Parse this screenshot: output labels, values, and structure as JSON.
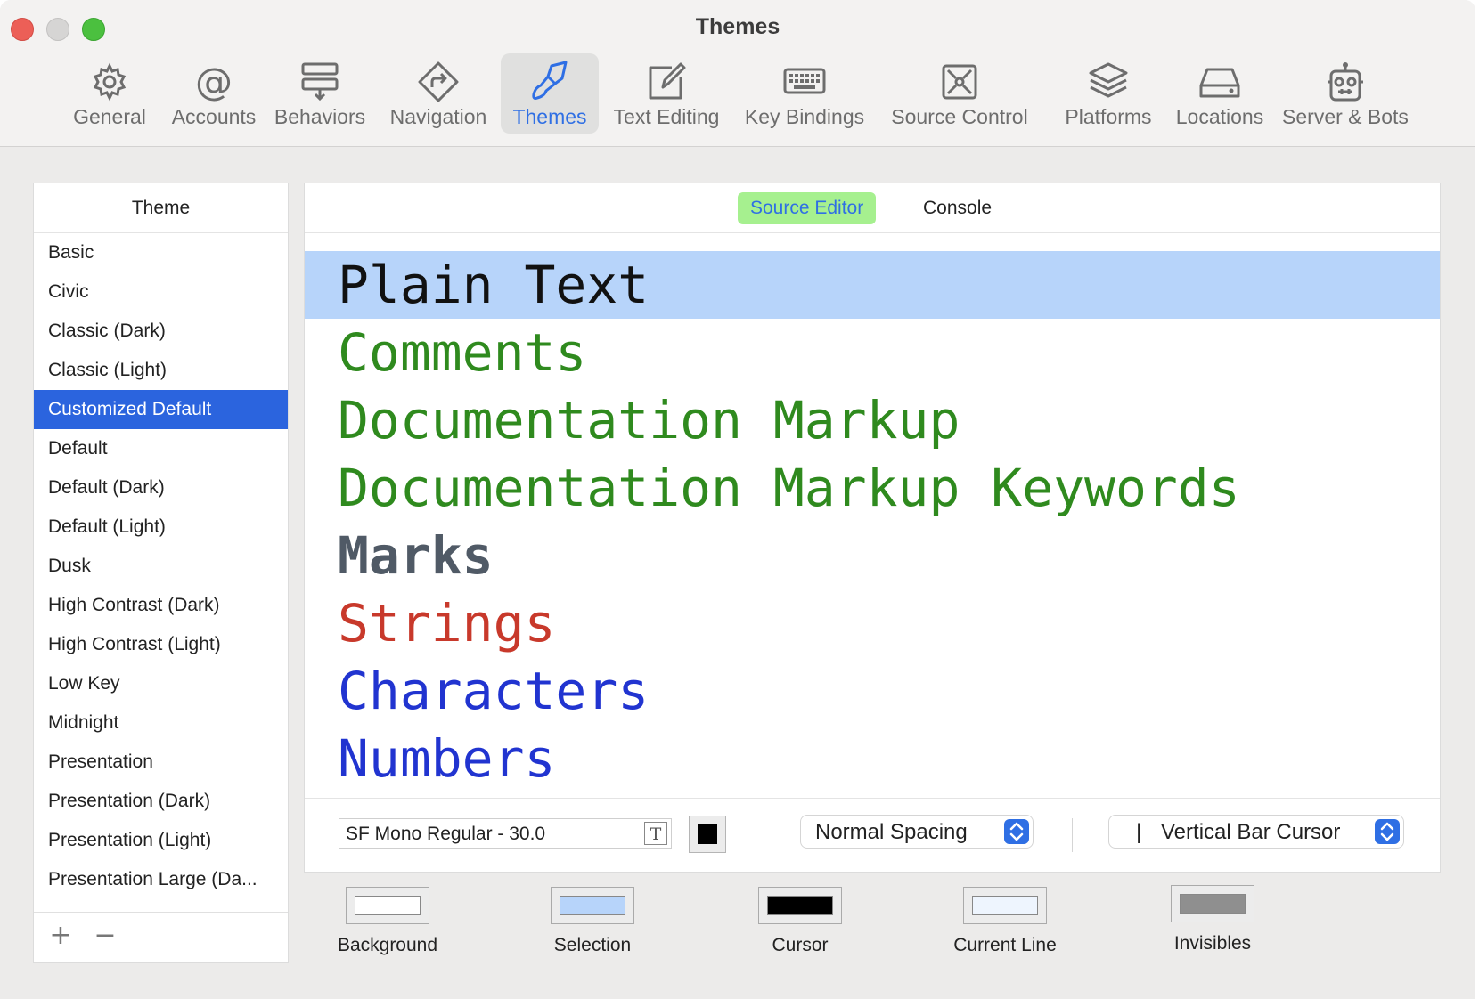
{
  "window": {
    "title": "Themes"
  },
  "toolbar": {
    "items": [
      {
        "label": "General",
        "icon": "gear-icon"
      },
      {
        "label": "Accounts",
        "icon": "at-sign-icon"
      },
      {
        "label": "Behaviors",
        "icon": "behaviors-icon"
      },
      {
        "label": "Navigation",
        "icon": "navigation-arrow-icon"
      },
      {
        "label": "Themes",
        "icon": "paintbrush-icon",
        "selected": true
      },
      {
        "label": "Text Editing",
        "icon": "pencil-square-icon"
      },
      {
        "label": "Key Bindings",
        "icon": "keyboard-icon"
      },
      {
        "label": "Source Control",
        "icon": "source-control-icon"
      },
      {
        "label": "Platforms",
        "icon": "stacked-layers-icon"
      },
      {
        "label": "Locations",
        "icon": "drive-icon"
      },
      {
        "label": "Server & Bots",
        "icon": "robot-icon"
      }
    ]
  },
  "theme_list": {
    "header": "Theme",
    "items": [
      "Basic",
      "Civic",
      "Classic (Dark)",
      "Classic (Light)",
      "Customized Default",
      "Default",
      "Default (Dark)",
      "Default (Light)",
      "Dusk",
      "High Contrast (Dark)",
      "High Contrast (Light)",
      "Low Key",
      "Midnight",
      "Presentation",
      "Presentation (Dark)",
      "Presentation (Light)",
      "Presentation Large (Da..."
    ],
    "selected": "Customized Default",
    "add_label": "+",
    "remove_label": "−"
  },
  "editor": {
    "tabs": {
      "active": "Source Editor",
      "inactive": "Console"
    },
    "samples": [
      {
        "label": "Plain Text",
        "color": "#111111",
        "selected": true
      },
      {
        "label": "Comments",
        "color": "#2f8a1e"
      },
      {
        "label": "Documentation Markup",
        "color": "#2f8a1e"
      },
      {
        "label": "Documentation Markup Keywords",
        "color": "#2f8a1e"
      },
      {
        "label": "Marks",
        "color": "#505a66",
        "bold": true
      },
      {
        "label": "Strings",
        "color": "#c8392b"
      },
      {
        "label": "Characters",
        "color": "#2134d0"
      },
      {
        "label": "Numbers",
        "color": "#2134d0"
      }
    ],
    "font": "SF Mono Regular - 30.0",
    "spacing": "Normal Spacing",
    "cursor_glyph": "|",
    "cursor": "Vertical Bar Cursor"
  },
  "swatches": [
    {
      "label": "Background",
      "color": "#ffffff"
    },
    {
      "label": "Selection",
      "color": "#b7d4fa"
    },
    {
      "label": "Cursor",
      "color": "#000000"
    },
    {
      "label": "Current Line",
      "color": "#eef5fe"
    },
    {
      "label": "Invisibles",
      "color": "#8f8f8f"
    }
  ],
  "colors": {
    "accent": "#2f6fe4",
    "selection_row": "#2b64de",
    "segment_active_bg": "#a6f08f"
  }
}
